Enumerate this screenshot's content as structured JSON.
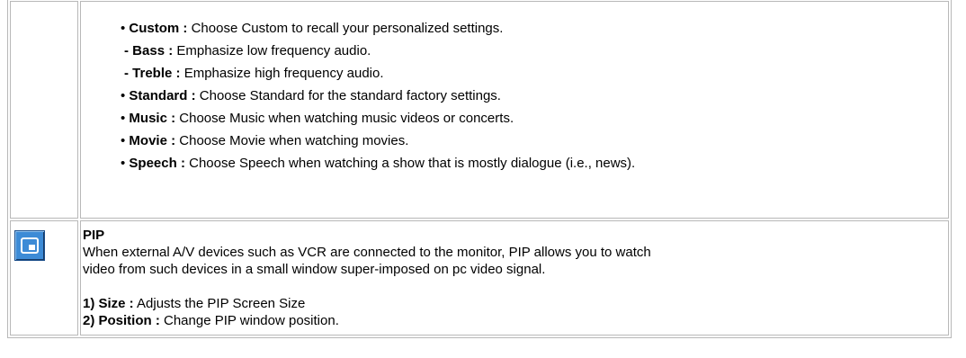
{
  "sound_modes": [
    {
      "bullet": "• ",
      "term": "Custom :",
      "desc": " Choose Custom to recall your personalized settings."
    },
    {
      "bullet": "- ",
      "term": "Bass :",
      "desc": " Emphasize low frequency audio."
    },
    {
      "bullet": "- ",
      "term": "Treble :",
      "desc": " Emphasize high frequency audio."
    },
    {
      "bullet": "• ",
      "term": "Standard :",
      "desc": " Choose Standard for the standard factory settings."
    },
    {
      "bullet": "• ",
      "term": "Music :",
      "desc": " Choose Music when watching music videos or concerts."
    },
    {
      "bullet": "• ",
      "term": "Movie :",
      "desc": " Choose Movie when watching movies."
    },
    {
      "bullet": "• ",
      "term": "Speech :",
      "desc": " Choose Speech when watching a show that is mostly dialogue (i.e., news)."
    }
  ],
  "pip": {
    "icon": "pip-icon",
    "title": "PIP",
    "description_line1": "When external A/V devices such as VCR are connected to the monitor, PIP allows you to watch",
    "description_line2": "video from such devices in a small window super-imposed on pc video signal.",
    "options": [
      {
        "term": "1) Size :",
        "desc": " Adjusts the PIP Screen Size"
      },
      {
        "term": "2) Position :",
        "desc": " Change PIP window position."
      }
    ]
  },
  "colors": {
    "border": "#b8b8b8",
    "icon_blue": "#3d8bd6",
    "icon_border": "#1d4f8a"
  }
}
